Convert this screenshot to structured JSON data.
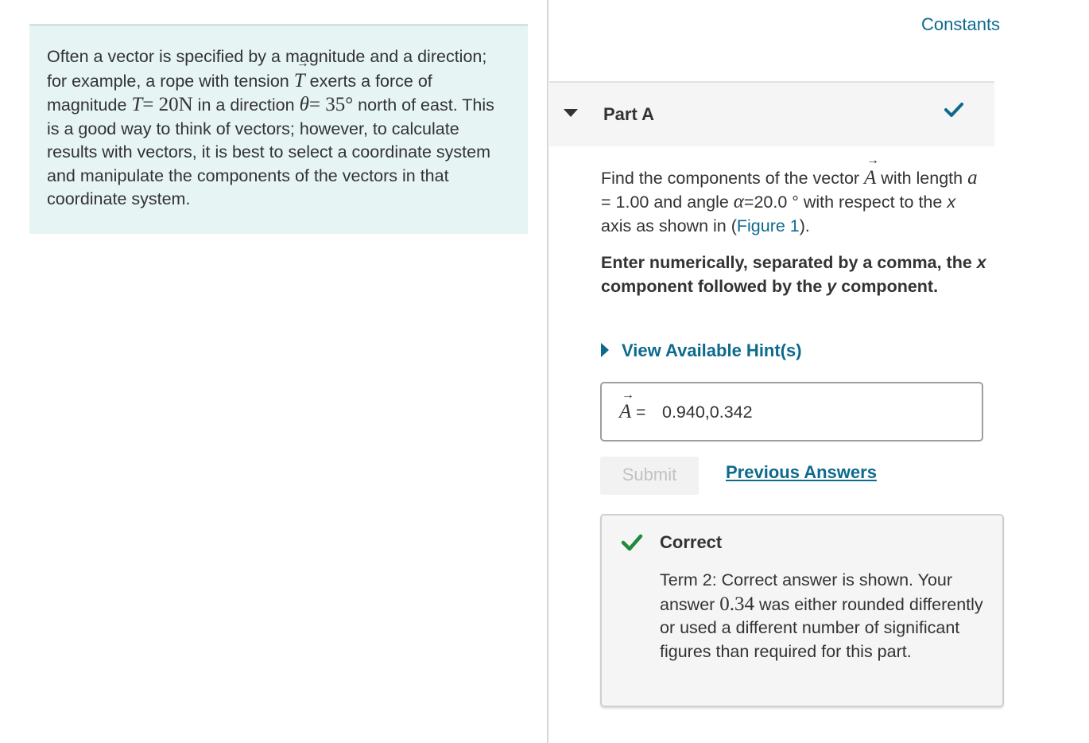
{
  "intro": {
    "t1": "Often a vector is specified by a magnitude and a direction; for example, a rope with tension ",
    "sym_T": "T",
    "t2": " exerts a force of magnitude ",
    "math_mag": "= 20N",
    "t3": " in a direction ",
    "sym_theta": "θ",
    "math_angle": "= 35°",
    "t4": " north of east. This is a good way to think of vectors; however, to calculate results with vectors, it is best to select a coordinate system and manipulate the components of the vectors in that coordinate system."
  },
  "header": {
    "constants_label": "Constants"
  },
  "part": {
    "title": "Part A",
    "status": "correct"
  },
  "question": {
    "q1": "Find the components of the vector ",
    "sym_A": "A",
    "q2": " with length ",
    "sym_a": "a",
    "q3": " = 1.00 and angle ",
    "sym_alpha": "α",
    "q4": "=20.0 ° with respect to the ",
    "x_axis": "x",
    "q5": " axis as shown in (",
    "figure_link": "Figure 1",
    "q6": ")."
  },
  "instruction": {
    "i1": "Enter numerically, separated by a comma, the ",
    "x": "x",
    "i2": " component followed by the ",
    "y": "y",
    "i3": " component."
  },
  "hints": {
    "label": "View Available Hint(s)"
  },
  "answer": {
    "symbol": "A",
    "equals": "=",
    "value": "0.940,0.342"
  },
  "actions": {
    "submit_label": "Submit",
    "previous_answers_label": "Previous Answers"
  },
  "feedback": {
    "title": "Correct",
    "f1": "Term 2: Correct answer is shown. Your answer ",
    "value": "0.34",
    "f2": " was either rounded differently or used a different number of significant figures than required for this part."
  },
  "colors": {
    "link": "#0d6a8e",
    "success": "#1f8a3d",
    "intro_bg": "#e6f4f4"
  }
}
